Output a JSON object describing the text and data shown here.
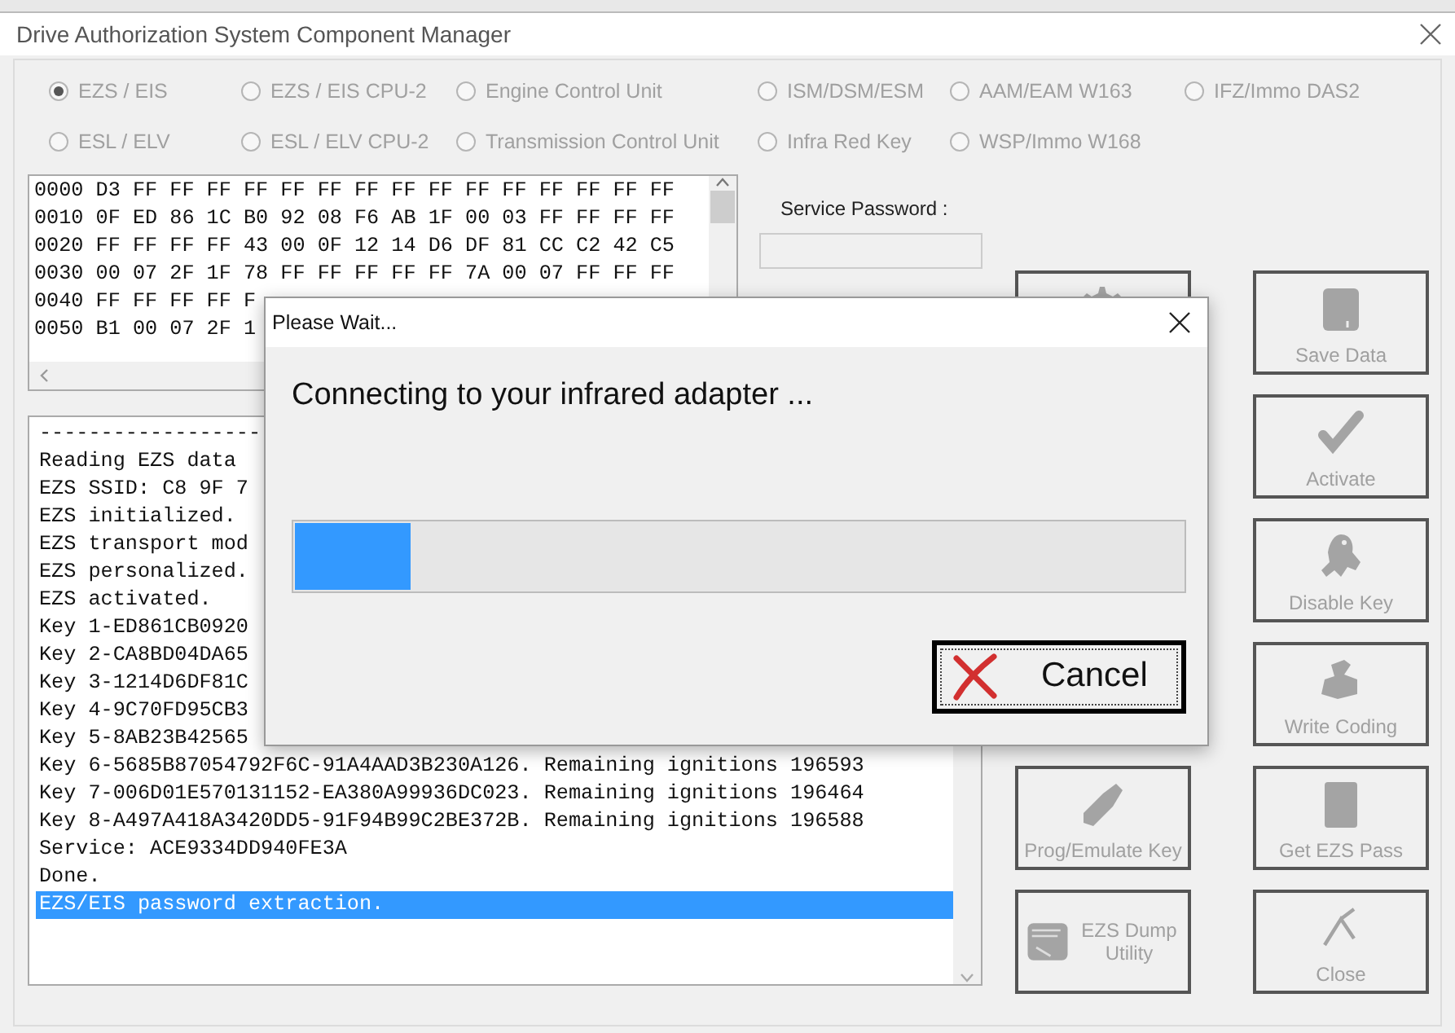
{
  "window": {
    "title": "Drive Authorization System Component Manager"
  },
  "modules": [
    {
      "label": "EZS / EIS",
      "selected": true,
      "disabled": true
    },
    {
      "label": "EZS / EIS CPU-2",
      "selected": false,
      "disabled": true
    },
    {
      "label": "Engine Control Unit",
      "selected": false,
      "disabled": true
    },
    {
      "label": "ISM/DSM/ESM",
      "selected": false,
      "disabled": true
    },
    {
      "label": "AAM/EAM W163",
      "selected": false,
      "disabled": true
    },
    {
      "label": "IFZ/Immo DAS2",
      "selected": false,
      "disabled": true
    },
    {
      "label": "ESL / ELV",
      "selected": false,
      "disabled": true
    },
    {
      "label": "ESL / ELV CPU-2",
      "selected": false,
      "disabled": true
    },
    {
      "label": "Transmission Control Unit",
      "selected": false,
      "disabled": true
    },
    {
      "label": "Infra Red Key",
      "selected": false,
      "disabled": true
    },
    {
      "label": "WSP/Immo W168",
      "selected": false,
      "disabled": true
    }
  ],
  "hex_dump": {
    "lines": [
      "0000 D3 FF FF FF FF FF FF FF FF FF FF FF FF FF FF FF",
      "0010 0F ED 86 1C B0 92 08 F6 AB 1F 00 03 FF FF FF FF",
      "0020 FF FF FF FF 43 00 0F 12 14 D6 DF 81 CC C2 42 C5",
      "0030 00 07 2F 1F 78 FF FF FF FF FF 7A 00 07 FF FF FF",
      "0040 FF FF FF FF F",
      "0050 B1 00 07 2F 1"
    ]
  },
  "service_password": {
    "label": "Service Password :"
  },
  "log": {
    "lines": [
      {
        "text": "------------------",
        "selected": false
      },
      {
        "text": "Reading EZS data",
        "selected": false
      },
      {
        "text": "EZS SSID: C8 9F 7",
        "selected": false
      },
      {
        "text": "EZS initialized.",
        "selected": false
      },
      {
        "text": "EZS transport mod",
        "selected": false
      },
      {
        "text": "EZS personalized.",
        "selected": false
      },
      {
        "text": "EZS activated.",
        "selected": false
      },
      {
        "text": "Key 1-ED861CB0920",
        "selected": false
      },
      {
        "text": "Key 2-CA8BD04DA65",
        "selected": false
      },
      {
        "text": "Key 3-1214D6DF81C",
        "selected": false
      },
      {
        "text": "Key 4-9C70FD95CB3",
        "selected": false
      },
      {
        "text": "Key 5-8AB23B42565",
        "selected": false
      },
      {
        "text": "Key 6-5685B87054792F6C-91A4AAD3B230A126. Remaining ignitions 196593",
        "selected": false
      },
      {
        "text": "Key 7-006D01E570131152-EA380A99936DC023. Remaining ignitions 196464",
        "selected": false
      },
      {
        "text": "Key 8-A497A418A3420DD5-91F94B99C2BE372B. Remaining ignitions 196588",
        "selected": false
      },
      {
        "text": "Service: ACE9334DD940FE3A",
        "selected": false
      },
      {
        "text": "Done.",
        "selected": false
      },
      {
        "text": "EZS/EIS password extraction.",
        "selected": true
      }
    ]
  },
  "actions_left": [
    {
      "disabled": true
    },
    {
      "label": "Prog/Emulate Key",
      "disabled": true
    },
    {
      "label": "EZS Dump Utility",
      "disabled": true
    }
  ],
  "actions_right": [
    {
      "label": "Save Data",
      "disabled": true
    },
    {
      "label": "Activate",
      "disabled": true
    },
    {
      "label": "Disable Key",
      "disabled": true
    },
    {
      "label": "Write Coding",
      "disabled": true
    },
    {
      "label": "Get EZS Pass",
      "disabled": true
    },
    {
      "label": "Close",
      "disabled": true
    }
  ],
  "dialog": {
    "title": "Please Wait...",
    "message": "Connecting to your infrared adapter ...",
    "progress": {
      "level": 0.13
    },
    "cancel_button": {
      "label": "Cancel"
    }
  }
}
